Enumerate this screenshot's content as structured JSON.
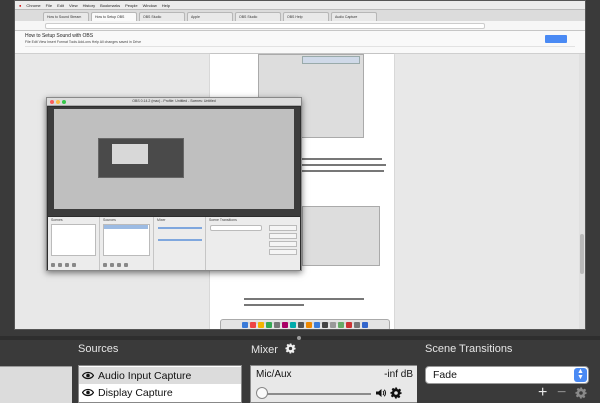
{
  "capture": {
    "menubar": [
      "Chrome",
      "File",
      "Edit",
      "View",
      "History",
      "Bookmarks",
      "People",
      "Window",
      "Help"
    ],
    "tabs": [
      "How to Sound Stream",
      "How to Setup OBS",
      "OBS Studio",
      "Apple",
      "OBS Studio",
      "OBS Help",
      "Audio Capture"
    ],
    "doc_title": "How to Setup Sound with OBS",
    "doc_menu": "File  Edit  View  Insert  Format  Tools  Add-ons  Help  All changes saved in Drive",
    "nested_window_title": "OBS 0.14.2 (mac) - Profile: Untitled - Scenes: Untitled",
    "nested_panels": [
      "Scenes",
      "Sources",
      "Mixer",
      "Scene Transitions"
    ]
  },
  "dock": {
    "sources": {
      "title": "Sources",
      "items": [
        {
          "label": "Audio Input Capture",
          "selected": true
        },
        {
          "label": "Display Capture",
          "selected": false
        }
      ]
    },
    "mixer": {
      "title": "Mixer",
      "channel": "Mic/Aux",
      "level": "-inf dB",
      "volume": 0.0
    },
    "transitions": {
      "title": "Scene Transitions",
      "selected": "Fade",
      "add": "+",
      "remove": "−"
    }
  },
  "colors": {
    "accent": "#4a8af4",
    "dock_bg": "#3a3a3a",
    "dark_bg": "#2b2b2b"
  }
}
